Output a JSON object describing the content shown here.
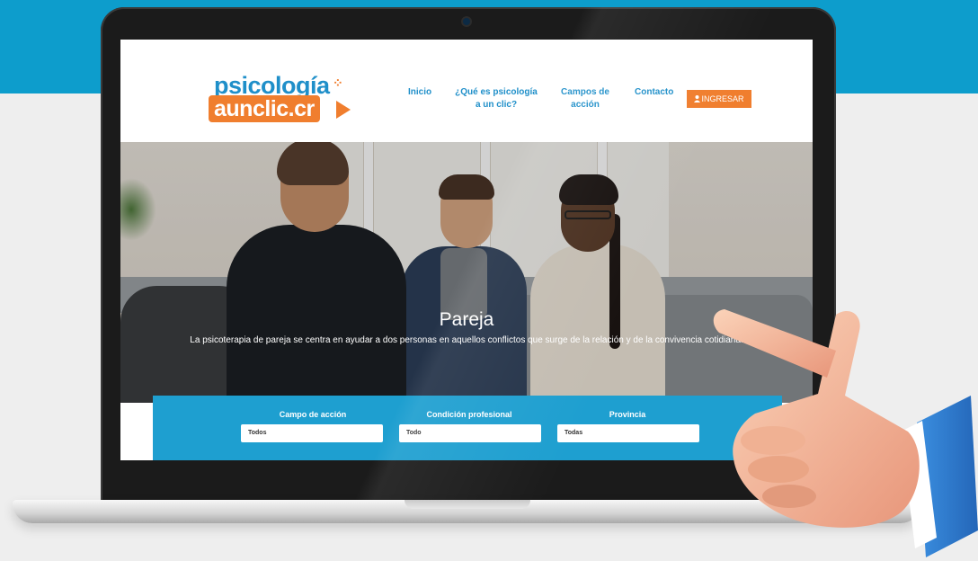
{
  "brand": {
    "logo_top": "psicología",
    "logo_bottom": "aunclic.cr"
  },
  "nav": {
    "items": [
      {
        "label": "Inicio"
      },
      {
        "label": "¿Qué es psicología a un clic?"
      },
      {
        "label": "Campos de acción"
      },
      {
        "label": "Contacto"
      }
    ],
    "login_label": "INGRESAR"
  },
  "hero": {
    "title": "Pareja",
    "description": "La psicoterapia de pareja se centra en ayudar a dos personas en aquellos conflictos que surge de la relación y de la convivencia cotidiana."
  },
  "search": {
    "filters": [
      {
        "label": "Campo de acción",
        "value": "Todos"
      },
      {
        "label": "Condición profesional",
        "value": "Todo"
      },
      {
        "label": "Provincia",
        "value": "Todas"
      }
    ]
  },
  "colors": {
    "brand_blue": "#1e9fd0",
    "brand_orange": "#f07e2e",
    "band_blue": "#0d9dcc"
  },
  "icons": [
    "user-icon",
    "pointing-hand-illustration",
    "webcam"
  ]
}
